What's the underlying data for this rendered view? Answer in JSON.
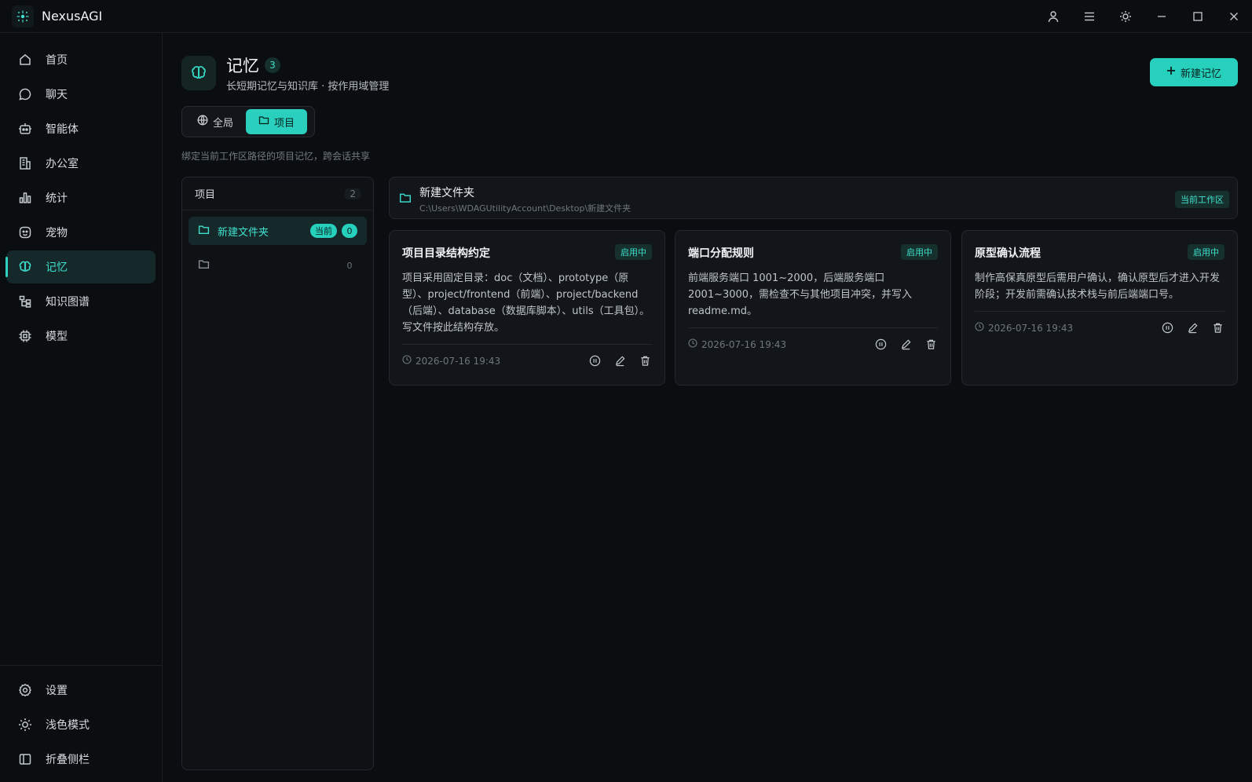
{
  "app": {
    "name": "NexusAGI"
  },
  "sidebar": {
    "items": [
      {
        "label": "首页",
        "icon": "home-icon"
      },
      {
        "label": "聊天",
        "icon": "chat-icon"
      },
      {
        "label": "智能体",
        "icon": "robot-icon"
      },
      {
        "label": "办公室",
        "icon": "office-icon"
      },
      {
        "label": "统计",
        "icon": "bar-chart-icon"
      },
      {
        "label": "宠物",
        "icon": "pet-icon"
      },
      {
        "label": "记忆",
        "icon": "brain-icon",
        "active": true
      },
      {
        "label": "知识图谱",
        "icon": "tree-icon"
      },
      {
        "label": "模型",
        "icon": "chip-icon"
      }
    ],
    "bottom": [
      {
        "label": "设置",
        "icon": "gear-icon"
      },
      {
        "label": "浅色模式",
        "icon": "sun-icon"
      },
      {
        "label": "折叠侧栏",
        "icon": "sidebar-collapse-icon"
      }
    ]
  },
  "page": {
    "title": "记忆",
    "count": "3",
    "subtitle": "长短期记忆与知识库 · 按作用域管理",
    "new_button": "新建记忆",
    "scope_tabs": [
      {
        "label": "全局",
        "icon": "globe-icon"
      },
      {
        "label": "项目",
        "icon": "folder-icon",
        "active": true
      }
    ],
    "hint": "绑定当前工作区路径的项目记忆，跨会话共享"
  },
  "projects": {
    "header": "项目",
    "count": "2",
    "items": [
      {
        "label": "新建文件夹",
        "current_tag": "当前",
        "count": "0",
        "selected": true
      },
      {
        "label": "",
        "count": "0"
      }
    ]
  },
  "workspace": {
    "name": "新建文件夹",
    "path": "C:\\Users\\WDAGUtilityAccount\\Desktop\\新建文件夹",
    "tag": "当前工作区"
  },
  "cards": [
    {
      "title": "项目目录结构约定",
      "status": "启用中",
      "body": "项目采用固定目录：doc（文档）、prototype（原型）、project/frontend（前端）、project/backend（后端）、database（数据库脚本）、utils（工具包）。写文件按此结构存放。",
      "date": "2026-07-16 19:43"
    },
    {
      "title": "端口分配规则",
      "status": "启用中",
      "body": "前端服务端口 1001~2000，后端服务端口 2001~3000，需检查不与其他项目冲突，并写入 readme.md。",
      "date": "2026-07-16 19:43"
    },
    {
      "title": "原型确认流程",
      "status": "启用中",
      "body": "制作高保真原型后需用户确认，确认原型后才进入开发阶段；开发前需确认技术栈与前后端端口号。",
      "date": "2026-07-16 19:43"
    }
  ],
  "colors": {
    "accent": "#27cfbd",
    "background": "#0b0e11"
  }
}
